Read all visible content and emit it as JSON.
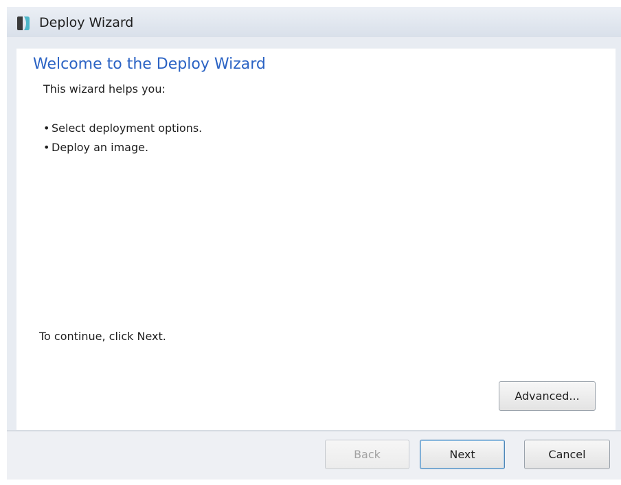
{
  "window": {
    "title": "Deploy Wizard",
    "icon": "deploy-wizard-app-icon"
  },
  "content": {
    "heading": "Welcome to the Deploy Wizard",
    "intro": "This wizard helps you:",
    "bullets": [
      "Select deployment options.",
      "Deploy an image."
    ],
    "bullet_glyph": "•",
    "continue_text": "To continue, click Next.",
    "advanced_label": "Advanced..."
  },
  "footer": {
    "back_label": "Back",
    "back_enabled": false,
    "next_label": "Next",
    "cancel_label": "Cancel"
  },
  "colors": {
    "heading": "#2b63c4",
    "titlebar": "#dfe5ee",
    "content_bg": "#ffffff",
    "disabled_text": "#a2a2a2",
    "default_button_border": "#4f86b6"
  }
}
